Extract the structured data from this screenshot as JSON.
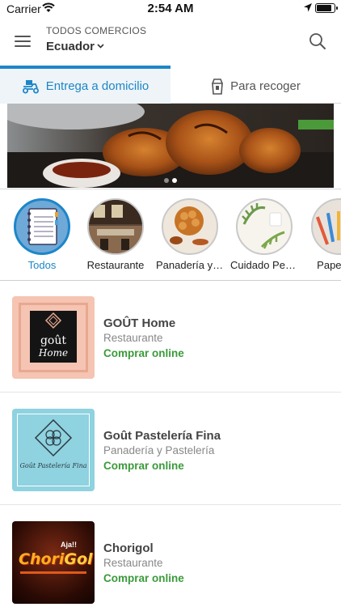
{
  "status_bar": {
    "carrier": "Carrier",
    "time": "2:54 AM"
  },
  "header": {
    "subtitle": "TODOS COMERCIOS",
    "country": "Ecuador"
  },
  "tabs": [
    {
      "label": "Entrega a domicilio",
      "active": true,
      "icon": "delivery-scooter-icon"
    },
    {
      "label": "Para recoger",
      "active": false,
      "icon": "shopping-bag-icon"
    }
  ],
  "banner": {
    "slide_count": 2,
    "active_slide": 2
  },
  "categories": [
    {
      "label": "Todos",
      "active": true
    },
    {
      "label": "Restaurante",
      "active": false
    },
    {
      "label": "Panadería y Pastelería",
      "active": false
    },
    {
      "label": "Cuidado Personal",
      "active": false
    },
    {
      "label": "Papelería",
      "active": false
    }
  ],
  "stores": [
    {
      "name": "GOÛT Home",
      "category": "Restaurante",
      "action": "Comprar online",
      "logo_text": [
        "goût",
        "Home"
      ]
    },
    {
      "name": "Goût Pastelería Fina",
      "category": "Panadería y Pastelería",
      "action": "Comprar online",
      "logo_text": [
        "Goût Pastelería Fina"
      ]
    },
    {
      "name": "Chorigol",
      "category": "Restaurante",
      "action": "Comprar online",
      "logo_text": [
        "Chori",
        "Gol",
        "Aja!!"
      ]
    }
  ],
  "colors": {
    "accent": "#1d86c8",
    "action_green": "#3a9a3a",
    "tab_active_bg": "#eef4f8"
  }
}
